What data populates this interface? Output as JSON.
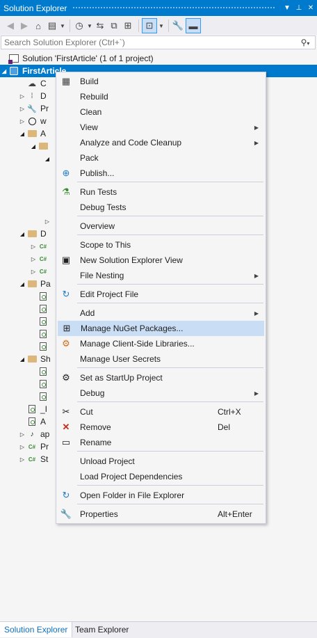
{
  "window": {
    "title": "Solution Explorer",
    "dropdown_glyph": "▼",
    "pin_glyph": "⊥",
    "close_glyph": "✕",
    "accent_color": "#007acc"
  },
  "toolbar": {
    "buttons": [
      {
        "icon": "back-icon",
        "glyph": "◀"
      },
      {
        "icon": "forward-icon",
        "glyph": "▶"
      },
      {
        "icon": "home-icon",
        "glyph": "⌂"
      },
      {
        "icon": "switch-views-icon",
        "glyph": "▤"
      },
      {
        "icon": "pending-changes-filter-icon",
        "glyph": "◷"
      },
      {
        "icon": "sync-icon",
        "glyph": "⇆"
      },
      {
        "icon": "collapse-all-icon",
        "glyph": "⧉"
      },
      {
        "icon": "show-all-files-icon",
        "glyph": "⊞"
      },
      {
        "icon": "preview-selected-icon",
        "glyph": "⊡"
      },
      {
        "icon": "properties-icon",
        "glyph": "🔧"
      },
      {
        "icon": "pin-preview-icon",
        "glyph": "▬"
      }
    ]
  },
  "search": {
    "placeholder": "Search Solution Explorer (Ctrl+`)",
    "icon": "search-icon",
    "glyph": "⚲",
    "dropdown_glyph": "▾"
  },
  "tree": {
    "solution_label": "Solution 'FirstArticle' (1 of 1 project)",
    "project_label": "FirstArticle",
    "rows": [
      {
        "text": "C",
        "icon": "cloud-icon"
      },
      {
        "text": "D",
        "icon": "dependencies-icon"
      },
      {
        "text": "Pr",
        "icon": "wrench-icon"
      },
      {
        "text": "w",
        "icon": "globe-icon"
      },
      {
        "text": "A",
        "icon": "folder-icon"
      },
      {
        "text": "",
        "icon": "folder-icon"
      },
      {
        "text": "",
        "icon": "blank-icon"
      },
      {
        "text": "",
        "icon": "blank-icon"
      },
      {
        "text": "D",
        "icon": "folder-icon"
      },
      {
        "text": "",
        "icon": "csharp-icon"
      },
      {
        "text": "",
        "icon": "csharp-icon"
      },
      {
        "text": "",
        "icon": "csharp-icon"
      },
      {
        "text": "Pa",
        "icon": "folder-icon"
      },
      {
        "text": "",
        "icon": "razor-page-icon"
      },
      {
        "text": "",
        "icon": "razor-page-icon"
      },
      {
        "text": "",
        "icon": "razor-page-icon"
      },
      {
        "text": "",
        "icon": "razor-page-icon"
      },
      {
        "text": "",
        "icon": "razor-page-icon"
      },
      {
        "text": "Sh",
        "icon": "folder-icon"
      },
      {
        "text": "",
        "icon": "razor-page-icon"
      },
      {
        "text": "",
        "icon": "razor-page-icon"
      },
      {
        "text": "",
        "icon": "razor-page-icon"
      },
      {
        "text": "_I",
        "icon": "razor-page-icon"
      },
      {
        "text": "A",
        "icon": "razor-page-icon"
      },
      {
        "text": "ap",
        "icon": "json-icon"
      },
      {
        "text": "Pr",
        "icon": "csharp-icon"
      },
      {
        "text": "St",
        "icon": "csharp-icon"
      }
    ]
  },
  "context_menu": {
    "items": [
      {
        "label": "Build",
        "icon": "build-icon",
        "glyph": "▦"
      },
      {
        "label": "Rebuild",
        "icon": "",
        "glyph": ""
      },
      {
        "label": "Clean",
        "icon": "",
        "glyph": ""
      },
      {
        "label": "View",
        "icon": "",
        "glyph": "",
        "submenu": "▶"
      },
      {
        "label": "Analyze and Code Cleanup",
        "icon": "",
        "glyph": "",
        "submenu": "▶"
      },
      {
        "label": "Pack",
        "icon": "",
        "glyph": ""
      },
      {
        "label": "Publish...",
        "icon": "publish-icon",
        "glyph": "⊕"
      },
      {
        "label": "Run Tests",
        "icon": "run-tests-icon",
        "glyph": "⚗"
      },
      {
        "label": "Debug Tests",
        "icon": "",
        "glyph": ""
      },
      {
        "label": "Overview",
        "icon": "",
        "glyph": ""
      },
      {
        "label": "Scope to This",
        "icon": "",
        "glyph": ""
      },
      {
        "label": "New Solution Explorer View",
        "icon": "new-view-icon",
        "glyph": "▣"
      },
      {
        "label": "File Nesting",
        "icon": "",
        "glyph": "",
        "submenu": "▶"
      },
      {
        "label": "Edit Project File",
        "icon": "edit-project-icon",
        "glyph": "↻"
      },
      {
        "label": "Add",
        "icon": "",
        "glyph": "",
        "submenu": "▶"
      },
      {
        "label": "Manage NuGet Packages...",
        "icon": "nuget-icon",
        "glyph": "⊞"
      },
      {
        "label": "Manage Client-Side Libraries...",
        "icon": "client-libraries-icon",
        "glyph": "⚙"
      },
      {
        "label": "Manage User Secrets",
        "icon": "",
        "glyph": ""
      },
      {
        "label": "Set as StartUp Project",
        "icon": "startup-icon",
        "glyph": "⚙"
      },
      {
        "label": "Debug",
        "icon": "",
        "glyph": "",
        "submenu": "▶"
      },
      {
        "label": "Cut",
        "icon": "cut-icon",
        "glyph": "✂",
        "shortcut": "Ctrl+X"
      },
      {
        "label": "Remove",
        "icon": "remove-icon",
        "glyph": "✕",
        "shortcut": "Del"
      },
      {
        "label": "Rename",
        "icon": "rename-icon",
        "glyph": "▭"
      },
      {
        "label": "Unload Project",
        "icon": "",
        "glyph": ""
      },
      {
        "label": "Load Project Dependencies",
        "icon": "",
        "glyph": ""
      },
      {
        "label": "Open Folder in File Explorer",
        "icon": "open-folder-icon",
        "glyph": "↻"
      },
      {
        "label": "Properties",
        "icon": "wrench-icon",
        "glyph": "🔧",
        "shortcut": "Alt+Enter"
      }
    ],
    "highlighted": "Manage NuGet Packages..."
  },
  "bottom_tabs": {
    "active": "Solution Explorer",
    "inactive": "Team Explorer"
  }
}
